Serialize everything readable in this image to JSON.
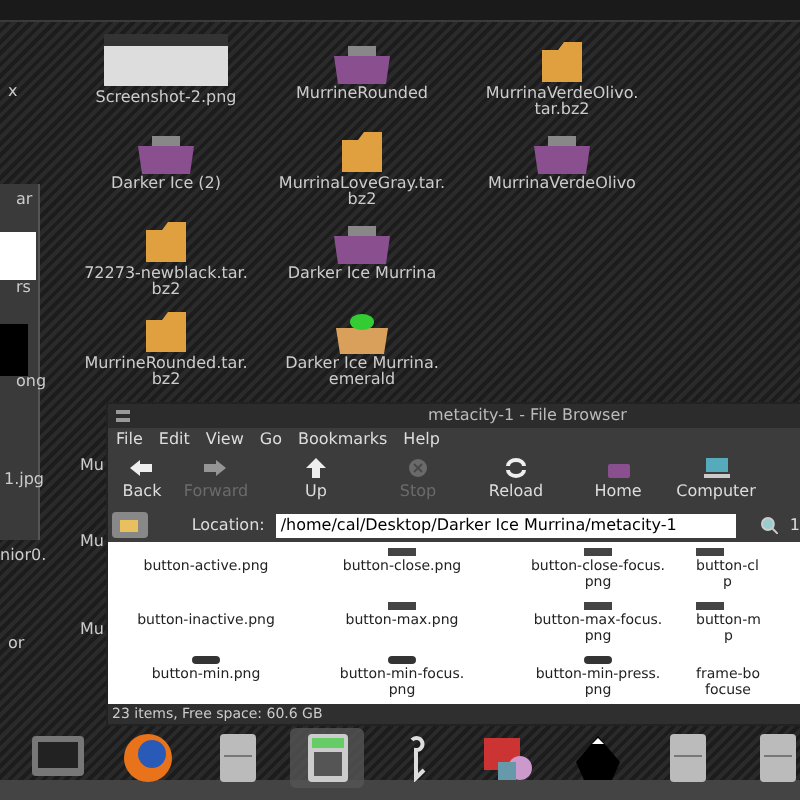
{
  "edge_texts": [
    "x",
    "ar",
    "rs",
    "ong",
    "1.jpg",
    "nior0.",
    "or"
  ],
  "behind_texts": [
    "Mu",
    "Mu",
    "Mu"
  ],
  "desktop_icons": [
    {
      "kind": "image",
      "label": "Screenshot-2.png"
    },
    {
      "kind": "folder",
      "label": "MurrineRounded"
    },
    {
      "kind": "archive",
      "label": "MurrinaVerdeOlivo.\ntar.bz2"
    },
    {
      "kind": "folder",
      "label": "Darker Ice (2)"
    },
    {
      "kind": "archive",
      "label": "MurrinaLoveGray.tar.\nbz2"
    },
    {
      "kind": "folder",
      "label": "MurrinaVerdeOlivo"
    },
    {
      "kind": "archive",
      "label": "72273-newblack.tar.\nbz2"
    },
    {
      "kind": "folder",
      "label": "Darker Ice Murrina"
    },
    {
      "kind": "archive",
      "label": "MurrineRounded.tar.\nbz2"
    },
    {
      "kind": "package",
      "label": "Darker Ice Murrina.\nemerald"
    }
  ],
  "window": {
    "title": "metacity-1 - File Browser",
    "menu": [
      "File",
      "Edit",
      "View",
      "Go",
      "Bookmarks",
      "Help"
    ],
    "toolbar": [
      {
        "kind": "back",
        "label": "Back",
        "disabled": false
      },
      {
        "kind": "forward",
        "label": "Forward",
        "disabled": true
      },
      {
        "kind": "up",
        "label": "Up",
        "disabled": false
      },
      {
        "kind": "stop",
        "label": "Stop",
        "disabled": true
      },
      {
        "kind": "reload",
        "label": "Reload",
        "disabled": false
      },
      {
        "kind": "home",
        "label": "Home",
        "disabled": false
      },
      {
        "kind": "computer",
        "label": "Computer",
        "disabled": false
      }
    ],
    "location_label": "Location:",
    "location": "/home/cal/Desktop/Darker Ice Murrina/metacity-1",
    "zoom_text": "1",
    "files": [
      {
        "name": "button-active.png",
        "kind": "plain"
      },
      {
        "name": "button-close.png",
        "kind": "bar"
      },
      {
        "name": "button-close-focus.\npng",
        "kind": "bar"
      },
      {
        "name": "button-cl\np",
        "kind": "bar"
      },
      {
        "name": "button-inactive.png",
        "kind": "plain"
      },
      {
        "name": "button-max.png",
        "kind": "bar"
      },
      {
        "name": "button-max-focus.\npng",
        "kind": "bar"
      },
      {
        "name": "button-m\np",
        "kind": "bar"
      },
      {
        "name": "button-min.png",
        "kind": "pill"
      },
      {
        "name": "button-min-focus.\npng",
        "kind": "pill"
      },
      {
        "name": "button-min-press.\npng",
        "kind": "pill"
      },
      {
        "name": "frame-bo\nfocuse",
        "kind": "plain"
      }
    ],
    "status": "23 items, Free space: 60.6 GB"
  },
  "dock": [
    {
      "kind": "terminal",
      "selected": false
    },
    {
      "kind": "globe",
      "selected": false
    },
    {
      "kind": "cabinet",
      "selected": false
    },
    {
      "kind": "calculator",
      "selected": true
    },
    {
      "kind": "hook",
      "selected": false
    },
    {
      "kind": "media",
      "selected": false
    },
    {
      "kind": "blob",
      "selected": false
    },
    {
      "kind": "cabinet",
      "selected": false
    },
    {
      "kind": "cabinet",
      "selected": false
    }
  ]
}
